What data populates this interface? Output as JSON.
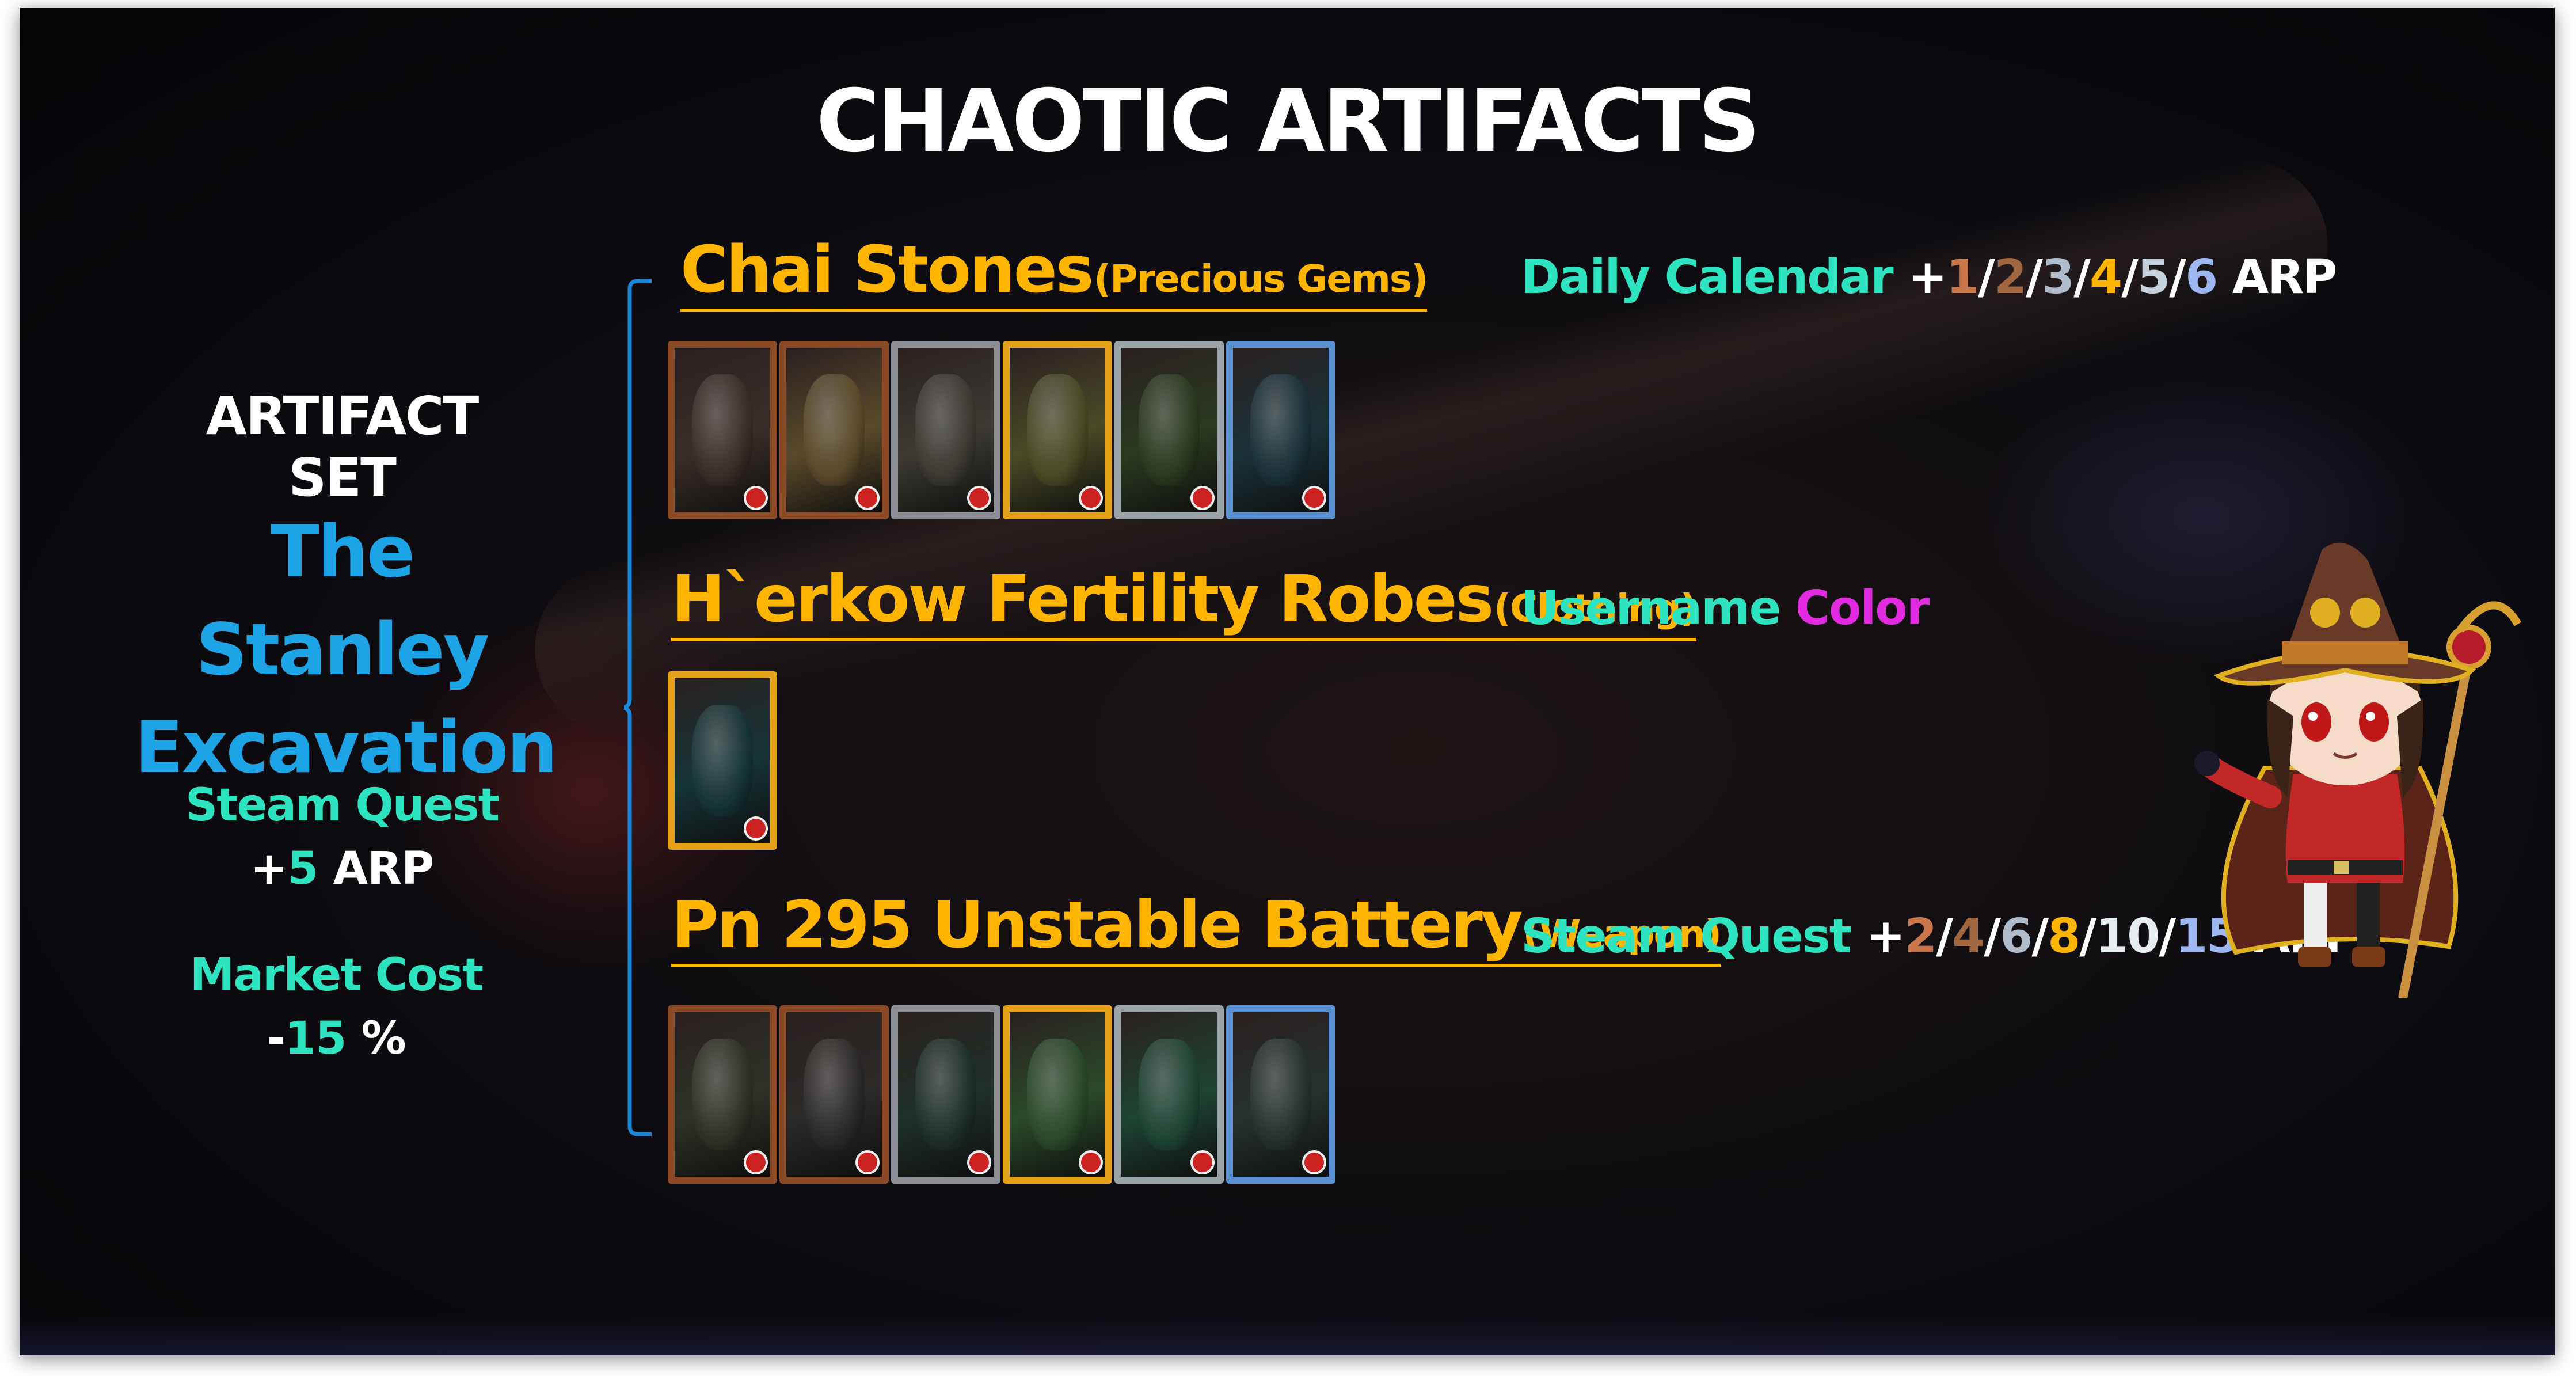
{
  "title": "CHAOTIC ARTIFACTS",
  "artifact_set": {
    "heading": "ARTIFACT SET",
    "name_line1": "The Stanley",
    "name_line2": "Excavation",
    "steam_quest": {
      "label": "Steam Quest",
      "prefix": "+",
      "value": "5",
      "unit": "ARP"
    },
    "market_cost": {
      "label": "Market Cost",
      "prefix": "-",
      "value": "15",
      "unit": "%"
    }
  },
  "sections": [
    {
      "name": "Chai Stones",
      "category": "(Precious Gems)",
      "perk_label": "Daily Calendar",
      "perk_prefix": "+",
      "perk_values": [
        {
          "text": "1",
          "color": "#c8764a"
        },
        {
          "text": "2",
          "color": "#a06640"
        },
        {
          "text": "3",
          "color": "#b0bccc"
        },
        {
          "text": "4",
          "color": "#ffb400"
        },
        {
          "text": "5",
          "color": "#c8d4dd"
        },
        {
          "text": "6",
          "color": "#9db8f0"
        }
      ],
      "perk_unit": "ARP",
      "cards": [
        {
          "frame": "#8a4a25",
          "art": "#3a2e28"
        },
        {
          "frame": "#8a4a25",
          "art": "#5a4a2a"
        },
        {
          "frame": "#8c8f95",
          "art": "#3c3a32"
        },
        {
          "frame": "#e3a21a",
          "art": "#4a4a26"
        },
        {
          "frame": "#9aa3a8",
          "art": "#2b3a20"
        },
        {
          "frame": "#5a8fd0",
          "art": "#1a3238"
        }
      ]
    },
    {
      "name": "H`erkow Fertility Robes",
      "category": "(Clothing)",
      "perk_label": "Username",
      "perk_value": "Color",
      "perk_value_color": "#e22be0",
      "cards": [
        {
          "frame": "#e3a21a",
          "art": "#163436"
        }
      ]
    },
    {
      "name": "Pn 295 Unstable Battery",
      "category": "(Weapon)",
      "perk_label": "Steam Quest",
      "perk_prefix": "+",
      "perk_values": [
        {
          "text": "2",
          "color": "#c8764a"
        },
        {
          "text": "4",
          "color": "#a06640"
        },
        {
          "text": "6",
          "color": "#b0bccc"
        },
        {
          "text": "8",
          "color": "#ffb400"
        },
        {
          "text": "10",
          "color": "#e6ecf0"
        },
        {
          "text": "15",
          "color": "#9db8f0"
        }
      ],
      "perk_unit": "ARP",
      "cards": [
        {
          "frame": "#8a4a25",
          "art": "#2e3226"
        },
        {
          "frame": "#8a4a25",
          "art": "#2c2a28"
        },
        {
          "frame": "#8c8f95",
          "art": "#1f3028"
        },
        {
          "frame": "#e3a21a",
          "art": "#2a4a2a"
        },
        {
          "frame": "#9aa3a8",
          "art": "#1e4434"
        },
        {
          "frame": "#5a8fd0",
          "art": "#26322e"
        }
      ]
    }
  ],
  "colors": {
    "accent_gold": "#ffb400",
    "accent_teal": "#2ee3c0",
    "set_blue": "#1ca4e6",
    "brace_blue": "#1c86d8"
  },
  "character": "chibi-witch-mascot"
}
